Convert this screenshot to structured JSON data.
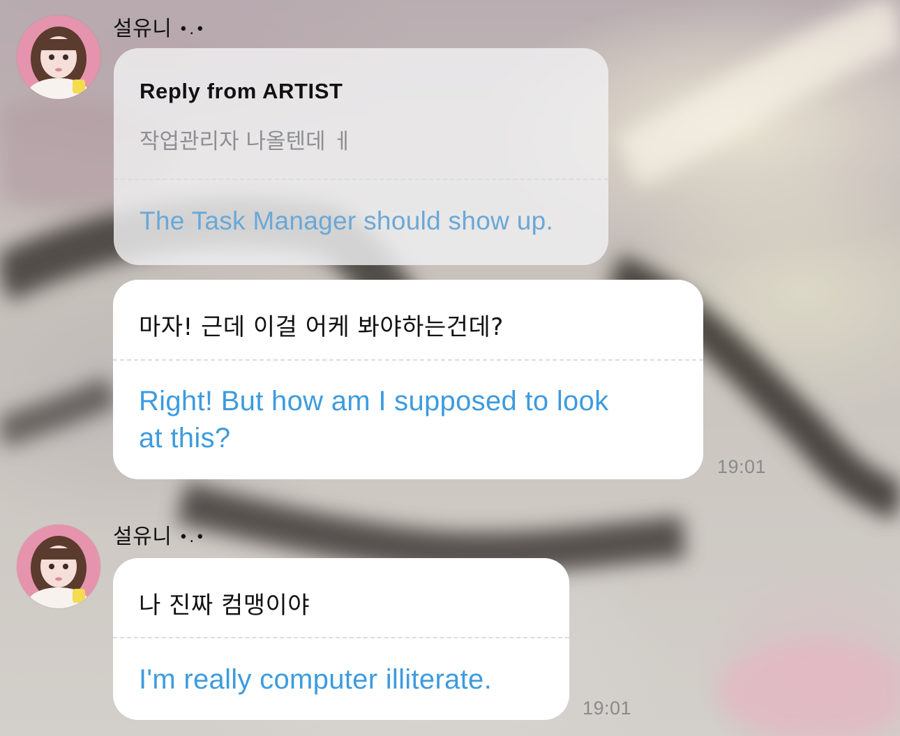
{
  "conversation": {
    "messages": [
      {
        "sender_name": "설유니",
        "sender_status": "•.•",
        "reply_block": {
          "title": "Reply from ARTIST",
          "original_text": "작업관리자 나올텐데 ㅔ",
          "translated_text": "The Task Manager should show up."
        },
        "original_text": "마자! 근데 이걸 어케 봐야하는건데?",
        "translated_text": "Right! But how am I supposed to look at this?",
        "translated_line_1": "Right! But how am I supposed to look",
        "translated_line_2": "at this?",
        "timestamp": "19:01"
      },
      {
        "sender_name": "설유니",
        "sender_status": "•.•",
        "original_text": "나 진짜 컴맹이야",
        "translated_text": "I'm really computer illiterate.",
        "timestamp": "19:01"
      }
    ]
  },
  "colors": {
    "translated_text": "#3d9bde",
    "reply_translated_text": "#6aa8d6",
    "bubble_background": "#ffffff",
    "reply_bubble_background": "#f0f0f2",
    "timestamp": "#8a8a8a"
  }
}
